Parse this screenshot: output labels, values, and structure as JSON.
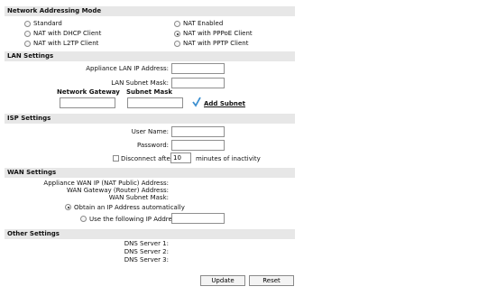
{
  "network_addressing": {
    "header": "Network Addressing Mode",
    "options": [
      {
        "label": "Standard",
        "selected": false
      },
      {
        "label": "NAT Enabled",
        "selected": false
      },
      {
        "label": "NAT with DHCP Client",
        "selected": false
      },
      {
        "label": "NAT with PPPoE Client",
        "selected": true
      },
      {
        "label": "NAT with L2TP Client",
        "selected": false
      },
      {
        "label": "NAT with PPTP Client",
        "selected": false
      }
    ]
  },
  "lan": {
    "header": "LAN Settings",
    "ip_label": "Appliance LAN IP Address:",
    "ip_value": "",
    "mask_label": "LAN Subnet Mask:",
    "mask_value": "",
    "col_gateway": "Network Gateway",
    "col_mask": "Subnet Mask",
    "add_subnet": "Add Subnet"
  },
  "isp": {
    "header": "ISP Settings",
    "username_label": "User Name:",
    "username_value": "",
    "password_label": "Password:",
    "password_value": "",
    "disconnect_label": "Disconnect after",
    "disconnect_value": "10",
    "inactivity_label": "minutes of inactivity"
  },
  "wan": {
    "header": "WAN Settings",
    "ip_label": "Appliance WAN IP (NAT Public) Address:",
    "gateway_label": "WAN Gateway (Router) Address:",
    "mask_label": "WAN Subnet Mask:",
    "obtain_label": "Obtain an IP Address automatically",
    "obtain_selected": true,
    "use_label": "Use the following IP Address:",
    "use_selected": false,
    "use_value": ""
  },
  "other": {
    "header": "Other Settings",
    "dns1": "DNS Server 1:",
    "dns2": "DNS Server 2:",
    "dns3": "DNS Server 3:"
  },
  "buttons": {
    "update": "Update",
    "reset": "Reset"
  },
  "colors": {
    "header_bg": "#e7e7e7",
    "checkmark": "#3b8fd0"
  }
}
